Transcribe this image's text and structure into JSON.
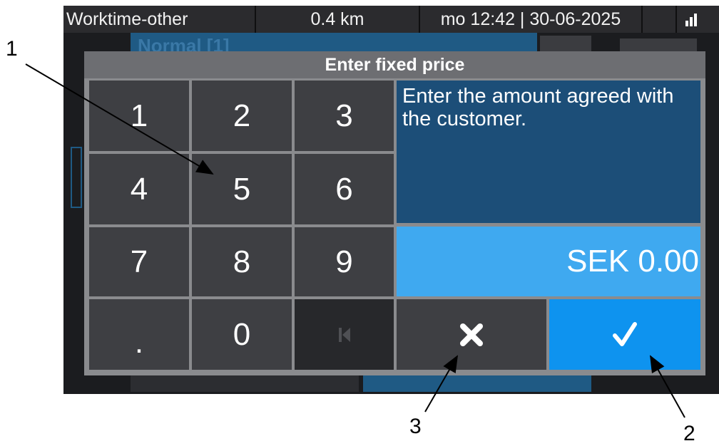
{
  "status_bar": {
    "mode": "Worktime-other",
    "distance": "0.4 km",
    "datetime": "mo 12:42 | 30-06-2025",
    "signal_icon": "signal-bars-icon"
  },
  "background": {
    "tariff_label": "Normal [1]"
  },
  "dialog": {
    "title": "Enter fixed price",
    "instruction": "Enter the amount agreed with the customer.",
    "amount": "SEK 0.00",
    "keys": [
      "1",
      "2",
      "3",
      "4",
      "5",
      "6",
      "7",
      "8",
      "9",
      ".",
      "0"
    ],
    "backspace_icon": "backspace-icon",
    "cancel_icon": "close-x-icon",
    "confirm_icon": "checkmark-icon"
  },
  "callouts": [
    "1",
    "2",
    "3"
  ],
  "colors": {
    "dialog_frame": "#8a8b8e",
    "key_bg": "#3e3f43",
    "info_bg": "#1c4e78",
    "amount_bg": "#3fa9f0",
    "confirm_bg": "#0e93ef"
  }
}
